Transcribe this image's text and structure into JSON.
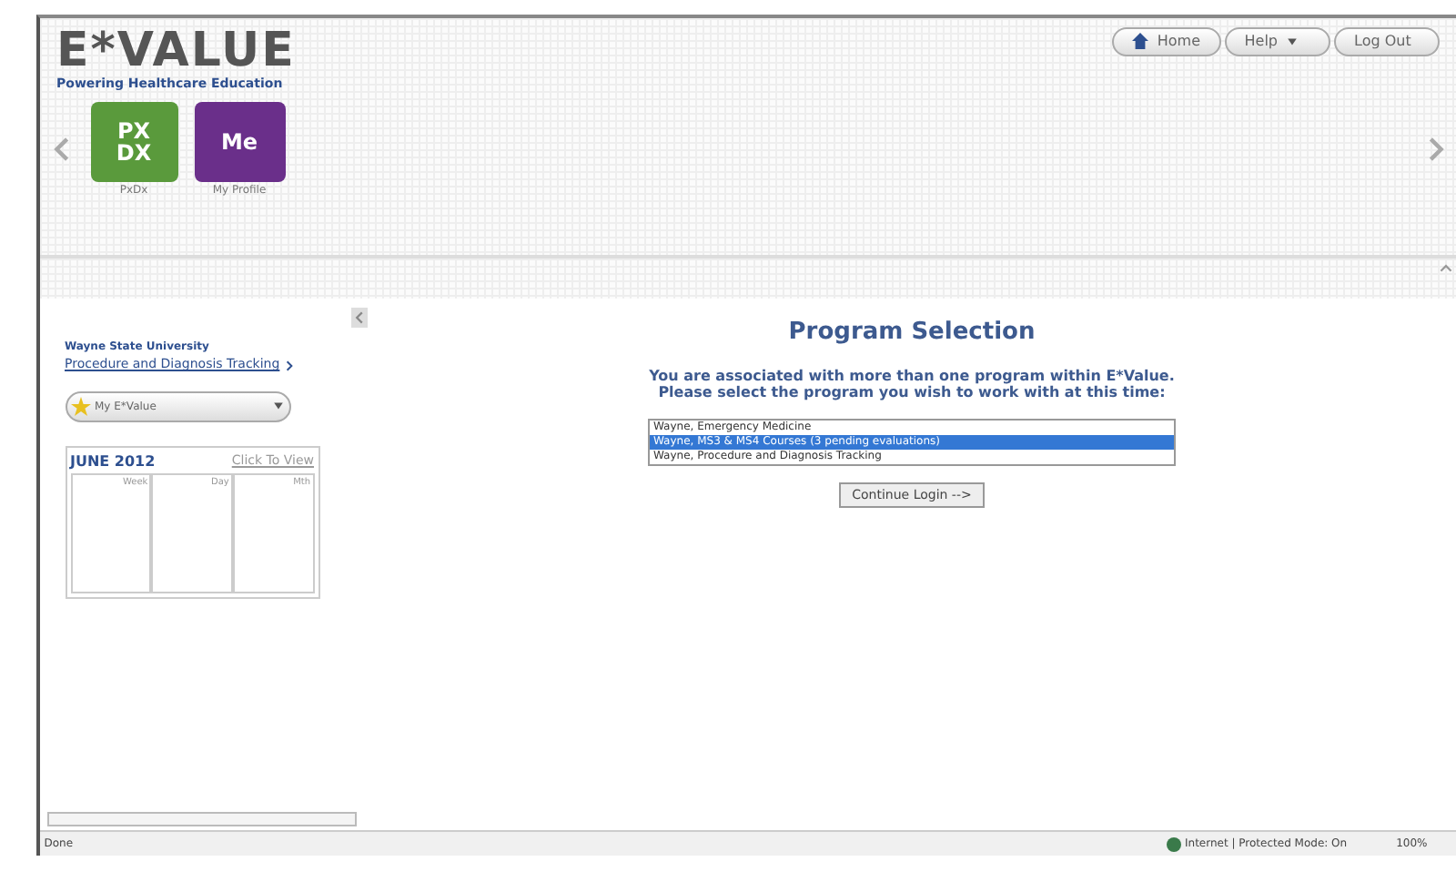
{
  "logo": {
    "title": "E*VALUE",
    "tagline": "Powering Healthcare Education"
  },
  "nav_buttons": [
    {
      "kind": "home",
      "label": "Home"
    },
    {
      "kind": "dropdown",
      "label": "Help"
    },
    {
      "kind": "plain",
      "label": "Log Out"
    }
  ],
  "apps": [
    {
      "kind": "pxdx",
      "icon_text": "PX DX",
      "label": "PxDx",
      "color": "#5a9a3c"
    },
    {
      "kind": "profile",
      "icon_text": "Me",
      "label": "My Profile",
      "color": "#6a2f8a"
    }
  ],
  "sidebar": {
    "institution": "Wayne State University",
    "program_link": "Procedure and Diagnosis Tracking",
    "menu": "My E*Value",
    "calendar": {
      "month": "JUNE 2012",
      "action": "Click To View",
      "columns": [
        "Week",
        "Day",
        "Mth"
      ]
    }
  },
  "main": {
    "title": "Program Selection",
    "message_1": "You are associated with more than one program within E*Value.",
    "message_2": "Please select the program you wish to work with at this time:",
    "programs": [
      {
        "label": "Wayne, Emergency Medicine",
        "selected": false
      },
      {
        "label": "Wayne, MS3 & MS4 Courses (3 pending evaluations)",
        "selected": true
      },
      {
        "label": "Wayne, Procedure and Diagnosis Tracking",
        "selected": false
      }
    ],
    "button": "Continue Login -->"
  },
  "status_bar": {
    "text": "Done",
    "zone": "Internet | Protected Mode: On",
    "zoom": "100%"
  }
}
